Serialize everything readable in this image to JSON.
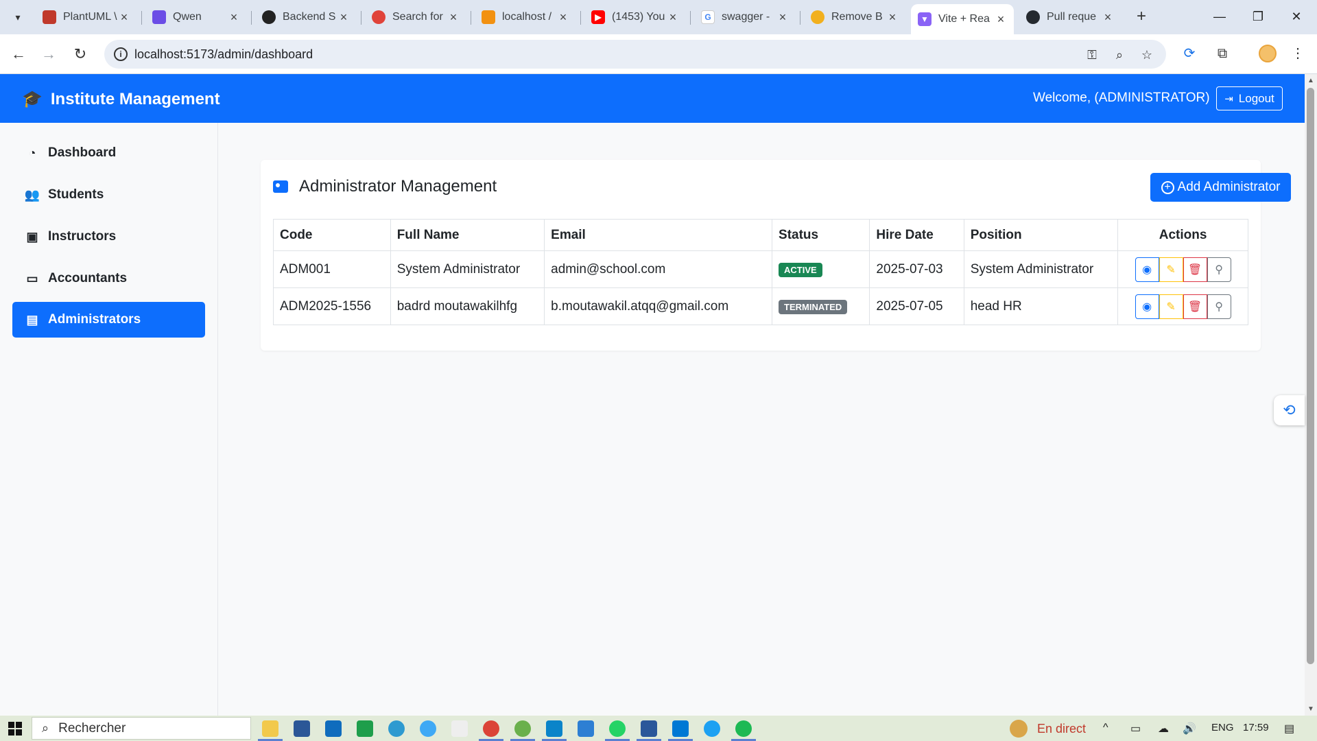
{
  "browser": {
    "tabs": [
      {
        "title": "PlantUML \\",
        "icon": "plantuml-icon",
        "color": "#c0392b"
      },
      {
        "title": "Qwen",
        "icon": "qwen-icon",
        "color": "#6b4de6"
      },
      {
        "title": "Backend S",
        "icon": "openai-icon",
        "color": "#222222"
      },
      {
        "title": "Search for",
        "icon": "search-tab-icon",
        "color": "#e0433a"
      },
      {
        "title": "localhost /",
        "icon": "phpmyadmin-icon",
        "color": "#f29111"
      },
      {
        "title": "(1453) You",
        "icon": "youtube-icon",
        "color": "#ff0000"
      },
      {
        "title": "swagger -",
        "icon": "google-icon",
        "color": "#4285f4"
      },
      {
        "title": "Remove B",
        "icon": "remove-bg-icon",
        "color": "#f2b01e"
      },
      {
        "title": "Vite + Rea",
        "icon": "vite-icon",
        "color": "#8a63f6",
        "active": true
      },
      {
        "title": "Pull reque",
        "icon": "github-icon",
        "color": "#24292f"
      }
    ],
    "url": "localhost:5173/admin/dashboard"
  },
  "header": {
    "brand": "Institute Management",
    "welcome": "Welcome, (ADMINISTRATOR)",
    "logout": "Logout"
  },
  "sidebar": {
    "items": [
      {
        "label": "Dashboard",
        "icon": "gauge-icon"
      },
      {
        "label": "Students",
        "icon": "people-icon"
      },
      {
        "label": "Instructors",
        "icon": "badge-icon"
      },
      {
        "label": "Accountants",
        "icon": "cash-icon"
      },
      {
        "label": "Administrators",
        "icon": "id-card-icon",
        "active": true
      }
    ]
  },
  "main": {
    "title": "Administrator Management",
    "add_button": "Add Administrator",
    "columns": [
      "Code",
      "Full Name",
      "Email",
      "Status",
      "Hire Date",
      "Position",
      "Actions"
    ],
    "rows": [
      {
        "code": "ADM001",
        "name": "System Administrator",
        "email": "admin@school.com",
        "status": "ACTIVE",
        "hire_date": "2025-07-03",
        "position": "System Administrator"
      },
      {
        "code": "ADM2025-1556",
        "name": "badrd moutawakilhfg",
        "email": "b.moutawakil.atqq@gmail.com",
        "status": "TERMINATED",
        "hire_date": "2025-07-05",
        "position": "head HR"
      }
    ]
  },
  "taskbar": {
    "search": "Rechercher",
    "news": "En direct",
    "lang": "ENG",
    "time": "17:59"
  },
  "colors": {
    "primary": "#0d6efd",
    "success": "#198754",
    "secondary": "#6c757d",
    "warning": "#ffc107",
    "danger": "#dc3545"
  }
}
